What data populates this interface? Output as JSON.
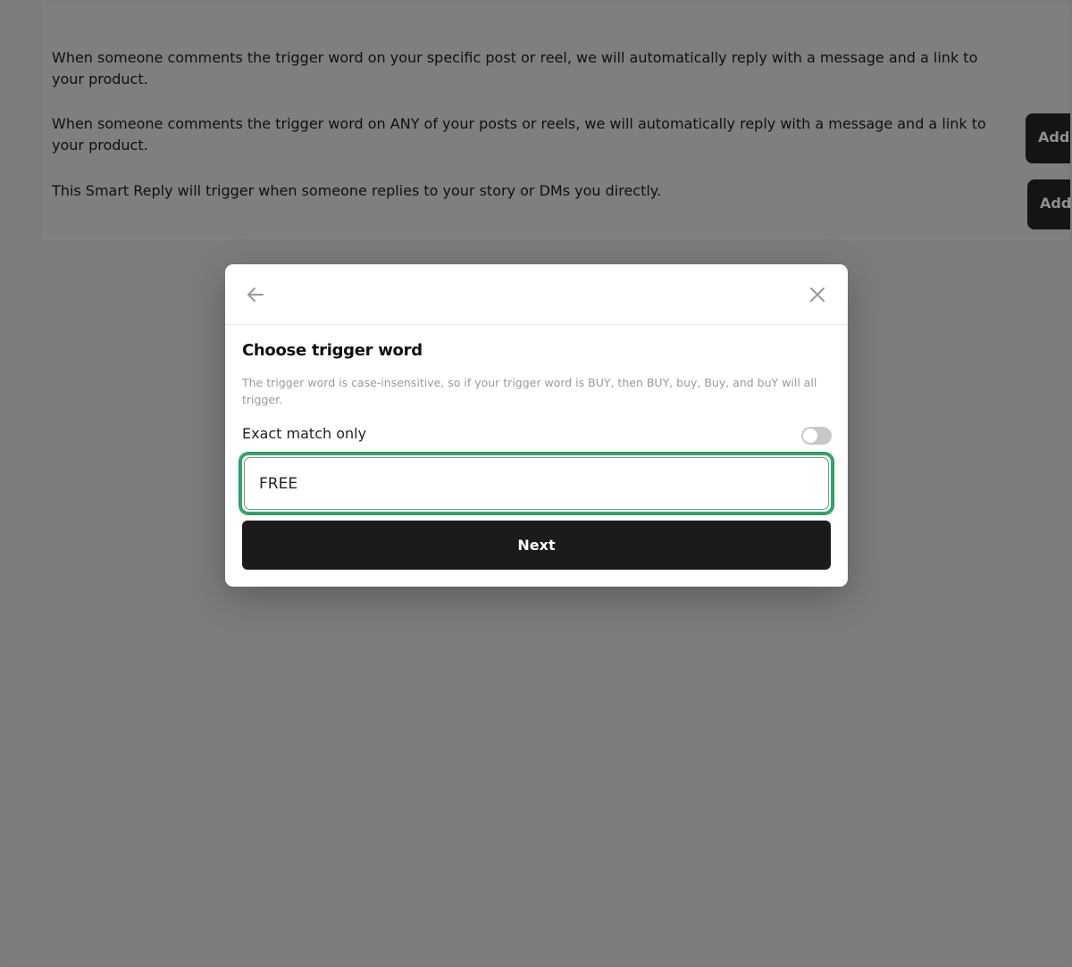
{
  "background": {
    "descriptions": [
      "When someone comments the trigger word on your specific post or reel, we will automatically reply with a message and a link to your product.",
      "When someone comments the trigger word on ANY of your posts or reels, we will automatically reply with a message and a link to your product.",
      "This Smart Reply will trigger when someone replies to your story or DMs you directly."
    ],
    "add_buttons": [
      "Add r",
      "Add"
    ]
  },
  "modal": {
    "back_icon": "arrow-left-icon",
    "close_icon": "close-icon",
    "title": "Choose trigger word",
    "help_text": "The trigger word is case-insensitive, so if your trigger word is BUY, then BUY, buy, Buy, and buY will all trigger.",
    "exact_match_label": "Exact match only",
    "exact_match_enabled": false,
    "trigger_value": "FREE",
    "next_label": "Next"
  },
  "colors": {
    "overlay": "#7b7b7b",
    "focus_ring": "#2fa868",
    "primary_button": "#1b1b1b"
  }
}
